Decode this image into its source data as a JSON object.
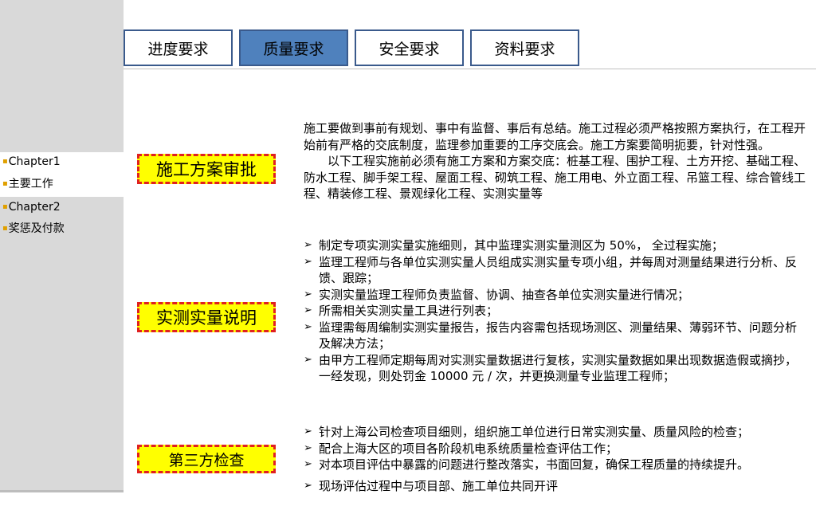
{
  "sidebar": {
    "items": [
      {
        "bullet": "▪",
        "label": "Chapter1"
      },
      {
        "bullet": "▪",
        "label": "主要工作"
      },
      {
        "bullet": "▪",
        "label": "Chapter2"
      },
      {
        "bullet": "▪",
        "label": "奖惩及付款"
      }
    ]
  },
  "tabs": [
    {
      "label": "进度要求",
      "active": false
    },
    {
      "label": "质量要求",
      "active": true
    },
    {
      "label": "安全要求",
      "active": false
    },
    {
      "label": "资料要求",
      "active": false
    }
  ],
  "sections": {
    "plan_review": {
      "label": "施工方案审批",
      "para1": "施工要做到事前有规划、事中有监督、事后有总结。施工过程必须严格按照方案执行，在工程开始前有严格的交底制度，监理参加重要的工序交底会。施工方案要简明扼要，针对性强。",
      "para2": "以下工程实施前必须有施工方案和方案交底：桩基工程、围护工程、土方开挖、基础工程、防水工程、脚手架工程、屋面工程、砌筑工程、施工用电、外立面工程、吊篮工程、综合管线工程、精装修工程、景观绿化工程、实测实量等"
    },
    "measurement": {
      "label": "实测实量说明",
      "items": [
        "制定专项实测实量实施细则，其中监理实测实量测区为 50%， 全过程实施；",
        "监理工程师与各单位实测实量人员组成实测实量专项小组，并每周对测量结果进行分析、反馈、跟踪；",
        "实测实量监理工程师负责监督、协调、抽查各单位实测实量进行情况；",
        "所需相关实测实量工具进行列表；",
        "监理需每周编制实测实量报告，报告内容需包括现场测区、测量结果、薄弱环节、问题分析及解决方法；",
        "由甲方工程师定期每周对实测实量数据进行复核，实测实量数据如果出现数据造假或摘抄，一经发现，则处罚金 10000 元 / 次，并更换测量专业监理工程师；"
      ]
    },
    "third_party": {
      "label": "第三方检查",
      "items": [
        "针对上海公司检查项目细则，组织施工单位进行日常实测实量、质量风险的检查；",
        "配合上海大区的项目各阶段机电系统质量检查评估工作；",
        "对本项目评估中暴露的问题进行整改落实，书面回复，确保工程质量的持续提升。",
        "现场评估过程中与项目部、施工单位共同开评"
      ]
    }
  },
  "colors": {
    "sidebar_bg": "#d9d9d9",
    "tab_border": "#3a5a8c",
    "tab_active": "#4f81bd",
    "label_bg": "#ffff00",
    "label_border": "#e02020",
    "bullet": "#e0a000"
  },
  "icons": {
    "bullet_icon": "square-bullet",
    "list_icon": "arrow-right-outline"
  }
}
